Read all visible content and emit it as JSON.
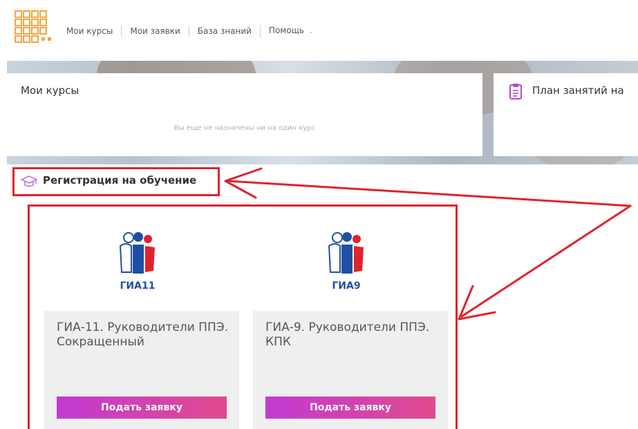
{
  "nav": {
    "items": [
      "Мои курсы",
      "Мои заявки",
      "База знаний",
      "Помощь"
    ]
  },
  "courses_card": {
    "title": "Мои курсы",
    "empty_message": "Вы еще не назначены ни на один курс"
  },
  "plan_card": {
    "title": "План занятий на"
  },
  "registration": {
    "title": "Регистрация на обучение",
    "courses": [
      {
        "logo_text": "ГИА11",
        "name": "ГИА-11. Руководители ППЭ. Сокращенный",
        "button": "Подать заявку"
      },
      {
        "logo_text": "ГИА9",
        "name": "ГИА-9. Руководители ППЭ. КПК",
        "button": "Подать заявку"
      }
    ]
  },
  "colors": {
    "accent_red": "#e0232c",
    "button_start": "#c33ad2",
    "button_end": "#e04a8e",
    "logo_orange": "#f2a541",
    "gia_blue": "#1f4fa3"
  }
}
